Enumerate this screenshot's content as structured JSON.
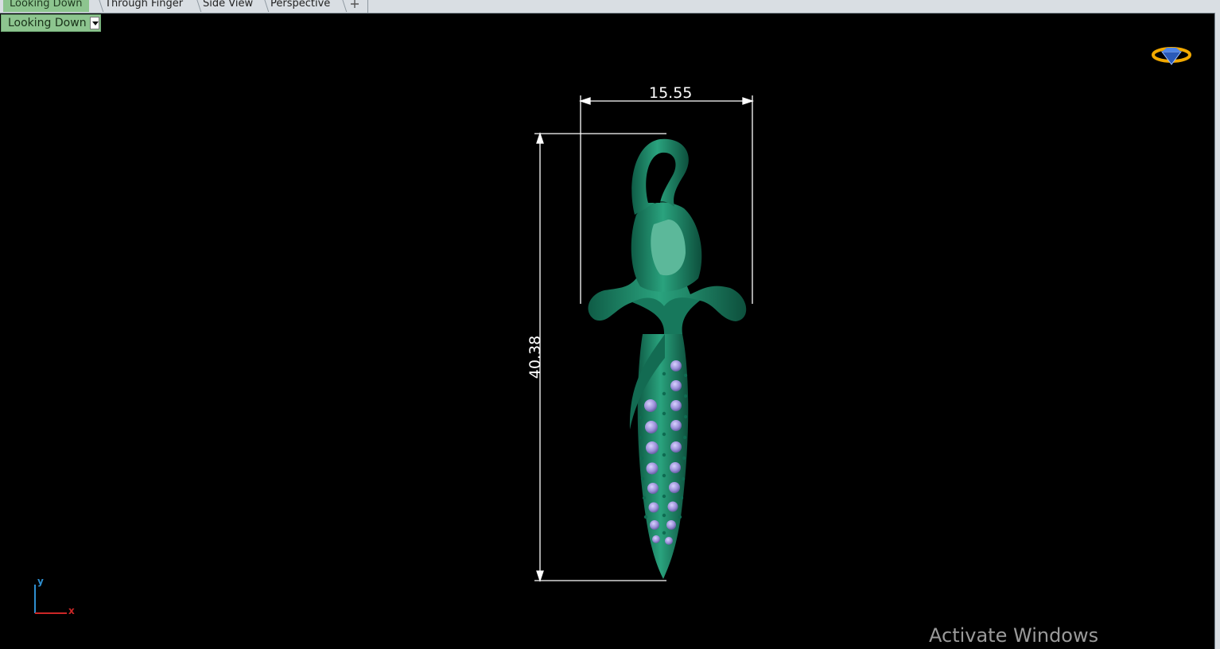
{
  "tabs": [
    {
      "label": "Looking Down",
      "active": true
    },
    {
      "label": "Through Finger",
      "active": false
    },
    {
      "label": "Side View",
      "active": false
    },
    {
      "label": "Perspective",
      "active": false
    }
  ],
  "add_tab_icon": "plus-icon",
  "viewport": {
    "selected": "Looking Down"
  },
  "dimensions": {
    "width": "15.55",
    "height": "40.38"
  },
  "axis": {
    "y": "y",
    "x": "x"
  },
  "watermark": "Activate Windows",
  "colors": {
    "model": "#1e8a6a",
    "gem": "#9a8fd6",
    "active_tab": "#8dc58f",
    "background": "#000000"
  }
}
